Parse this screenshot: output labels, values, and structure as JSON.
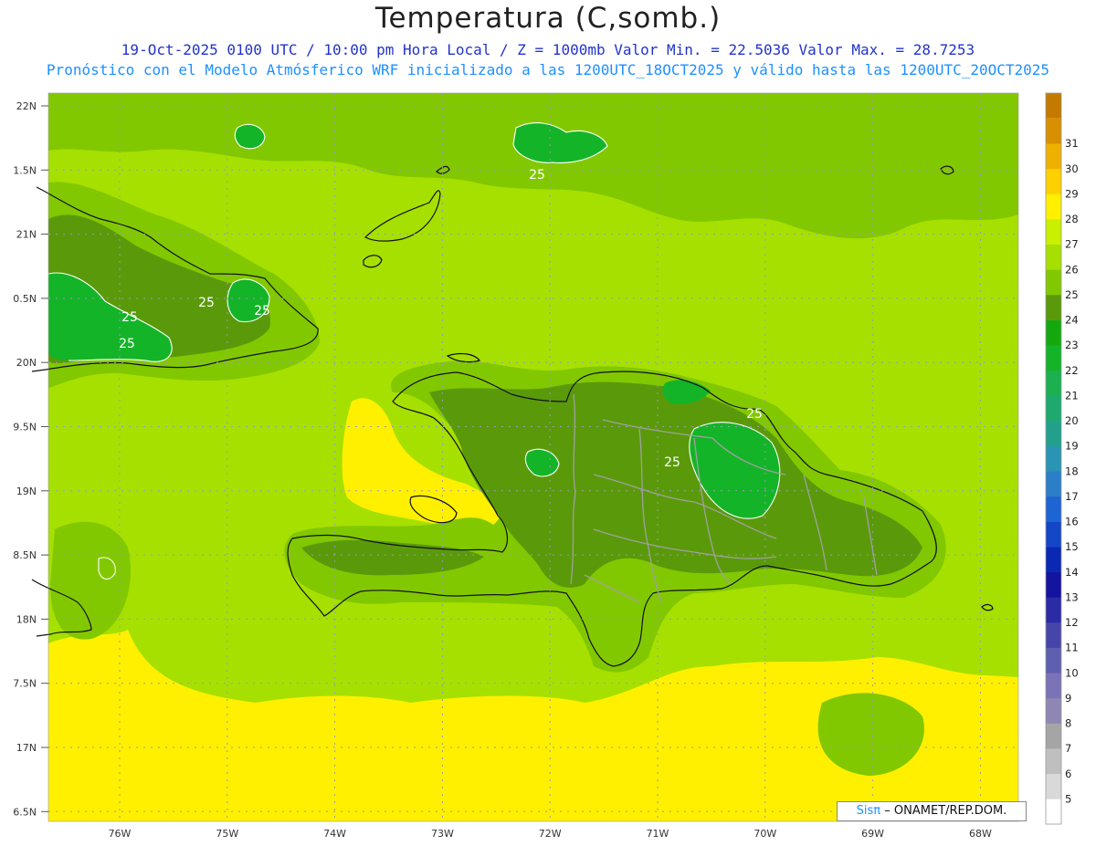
{
  "title": "Temperatura (C,somb.)",
  "subtitle_line1": "19-Oct-2025 0100 UTC / 10:00 pm Hora Local / Z = 1000mb  Valor Min. = 22.5036  Valor Max. = 28.7253",
  "subtitle_line2": "Pronóstico con el Modelo Atmósferico WRF inicializado a las 1200UTC_18OCT2025 y válido hasta las  1200UTC_20OCT2025",
  "lat_labels": [
    "22N",
    "1.5N",
    "21N",
    "0.5N",
    "20N",
    "9.5N",
    "19N",
    "8.5N",
    "18N",
    "7.5N",
    "17N",
    "6.5N"
  ],
  "lon_labels": [
    "76W",
    "75W",
    "74W",
    "73W",
    "72W",
    "71W",
    "70W",
    "69W",
    "68W"
  ],
  "colorbar": {
    "levels": [
      "5",
      "6",
      "7",
      "8",
      "9",
      "10",
      "11",
      "12",
      "13",
      "14",
      "15",
      "16",
      "17",
      "18",
      "19",
      "20",
      "21",
      "22",
      "23",
      "24",
      "25",
      "26",
      "27",
      "28",
      "29",
      "30",
      "31"
    ],
    "colors": [
      "#ffffff",
      "#d9d9d9",
      "#bfbfbf",
      "#a5a5a5",
      "#8f86b4",
      "#7a73b8",
      "#5f5fb0",
      "#4646aa",
      "#2b2ba6",
      "#1414a0",
      "#0a28b4",
      "#1446c8",
      "#1e64d2",
      "#2a7fc8",
      "#2a94b4",
      "#22a08c",
      "#1eaa6e",
      "#1cb050",
      "#14b428",
      "#14a80e",
      "#5a9a0a",
      "#82c800",
      "#a6e000",
      "#c8f000",
      "#fff000",
      "#ffd000",
      "#f0b000",
      "#d88f00"
    ],
    "top_color": "#c47a00"
  },
  "contour_labels": [
    "25",
    "25",
    "25",
    "25",
    "25",
    "25",
    "25"
  ],
  "field_colors": {
    "ocean": "#a6e000",
    "light": "#c8f000",
    "warm": "#fff000",
    "mid": "#82c800",
    "dark": "#5a9a0a",
    "cool": "#14b428"
  },
  "credit": {
    "logo": "Sisπ",
    "org": "– ONAMET/REP.DOM."
  }
}
